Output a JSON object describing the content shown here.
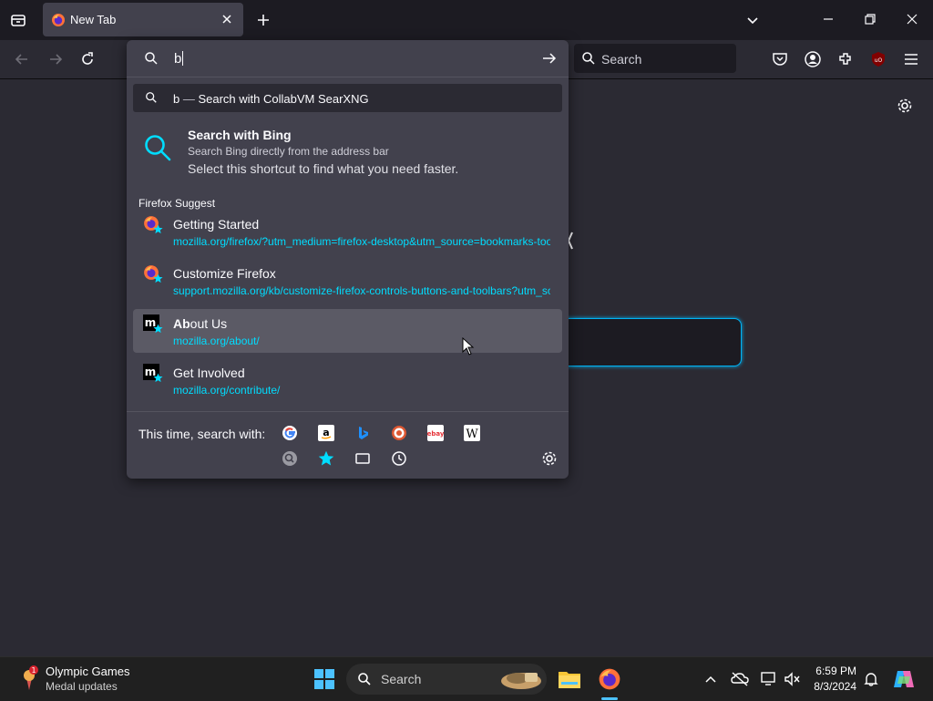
{
  "tab": {
    "title": "New Tab"
  },
  "urlbar": {
    "query": "b"
  },
  "first_result": {
    "query": "b",
    "separator": " — ",
    "action": "Search with CollabVM SearXNG"
  },
  "bing": {
    "title": "Search with Bing",
    "subtitle": "Search Bing directly from the address bar",
    "hint": "Select this shortcut to find what you need faster."
  },
  "suggest_header": "Firefox Suggest",
  "suggestions": [
    {
      "title": "Getting Started",
      "url": "mozilla.org/firefox/?utm_medium=firefox-desktop&utm_source=bookmarks-toolbar&utm_campaign=new-users&utm_content=-global",
      "icon": "firefox-icon"
    },
    {
      "title": "Customize Firefox",
      "url": "support.mozilla.org/kb/customize-firefox-controls-buttons-and-toolbars?utm_source=firefox",
      "icon": "firefox-icon"
    },
    {
      "title_bold": "Ab",
      "title_rest": "out Us",
      "url": "mozilla.org/about/",
      "icon": "mozilla-icon"
    },
    {
      "title": "Get Involved",
      "url": "mozilla.org/contribute/",
      "icon": "mozilla-icon"
    }
  ],
  "engines": {
    "label": "This time, search with:",
    "items": [
      "google-icon",
      "amazon-icon",
      "bing-icon",
      "duckduckgo-icon",
      "ebay-icon",
      "wikipedia-icon",
      "searxng-icon",
      "bookmarks-icon",
      "tabs-icon",
      "history-icon"
    ]
  },
  "searchbar": {
    "placeholder": "Search"
  },
  "taskbar": {
    "widget_title": "Olympic Games",
    "widget_sub": "Medal updates",
    "widget_badge": "1",
    "search": "Search",
    "time": "6:59 PM",
    "date": "8/3/2024"
  },
  "colors": {
    "accent": "#00ddff",
    "focus": "#00b3f4",
    "popup": "#42414d",
    "selected": "#5b5a65"
  }
}
